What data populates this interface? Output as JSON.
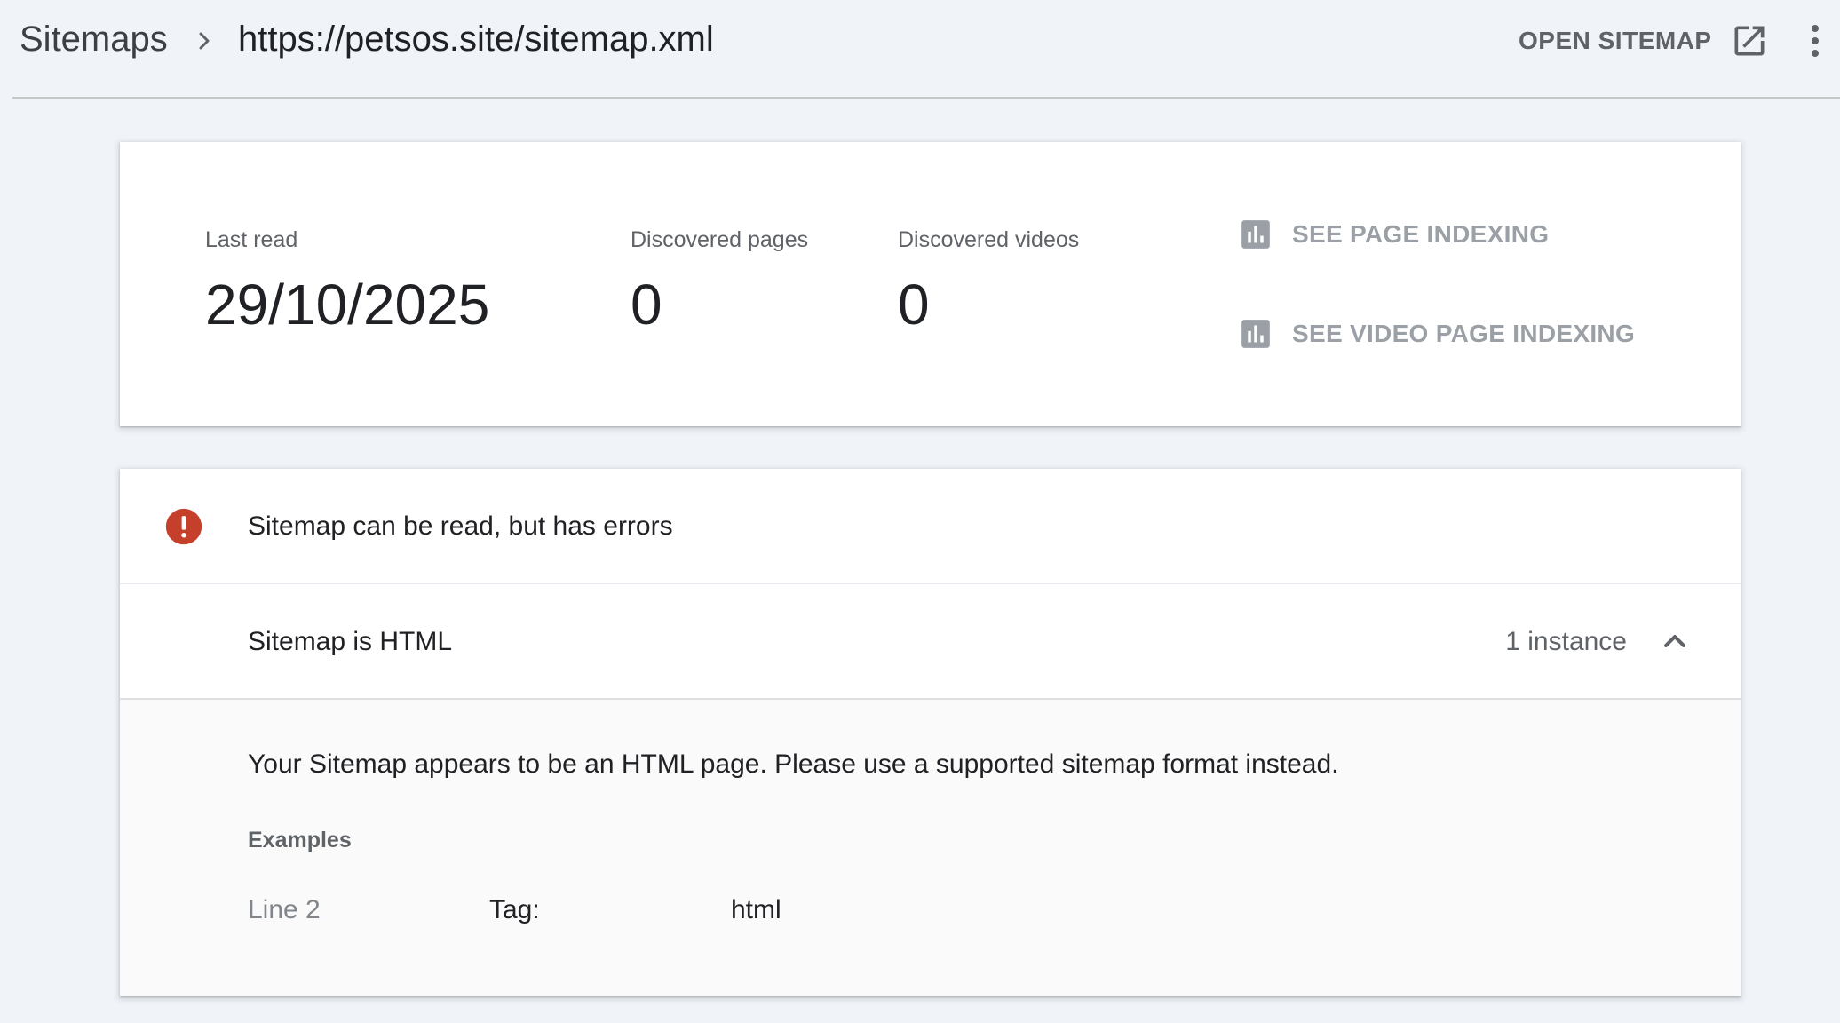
{
  "header": {
    "breadcrumb_root": "Sitemaps",
    "breadcrumb_current": "https://petsos.site/sitemap.xml",
    "open_sitemap_label": "OPEN SITEMAP"
  },
  "stats": {
    "last_read_label": "Last read",
    "last_read_value": "29/10/2025",
    "discovered_pages_label": "Discovered pages",
    "discovered_pages_value": "0",
    "discovered_videos_label": "Discovered videos",
    "discovered_videos_value": "0",
    "see_page_indexing_label": "SEE PAGE INDEXING",
    "see_video_page_indexing_label": "SEE VIDEO PAGE INDEXING"
  },
  "errors": {
    "status_title": "Sitemap can be read, but has errors",
    "issue": {
      "title": "Sitemap is HTML",
      "count": "1 instance",
      "description": "Your Sitemap appears to be an HTML page. Please use a supported sitemap format instead.",
      "examples_label": "Examples",
      "examples": [
        {
          "line": "Line 2",
          "tag_label": "Tag:",
          "tag_value": "html"
        }
      ]
    }
  },
  "colors": {
    "background": "#f0f4f9",
    "card": "#ffffff",
    "error_red": "#c5402b",
    "muted_text": "#5f6368",
    "disabled_link": "#9aa0a6"
  },
  "icons": {
    "breadcrumb_separator": "chevron-right-icon",
    "open_sitemap": "open-in-new-icon",
    "menu": "more-vert-icon",
    "indexing": "bar-chart-icon",
    "error": "error-icon",
    "collapse": "chevron-up-icon"
  }
}
